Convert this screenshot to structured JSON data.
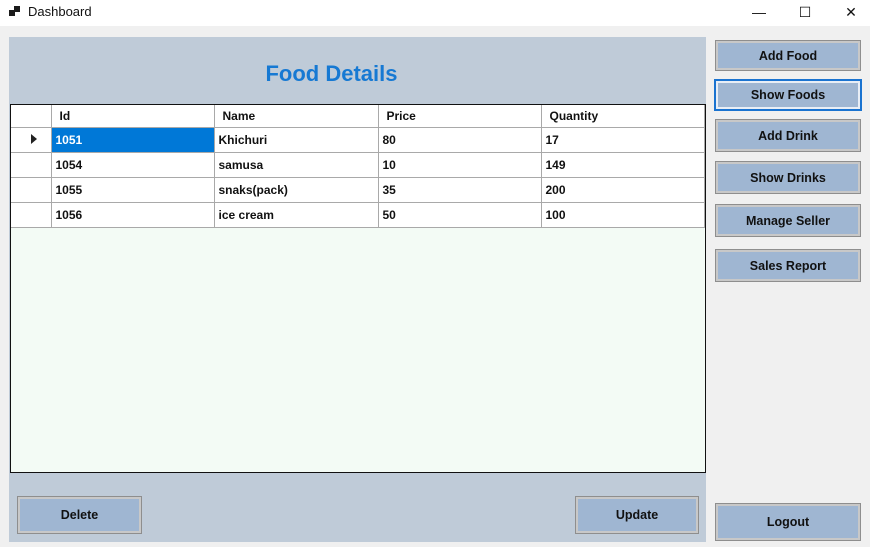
{
  "window": {
    "title": "Dashboard",
    "minimize_glyph": "—",
    "maximize_glyph": "☐",
    "close_glyph": "✕"
  },
  "main": {
    "heading": "Food Details",
    "table": {
      "columns": [
        "Id",
        "Name",
        "Price",
        "Quantity"
      ],
      "rows": [
        [
          "1051",
          "Khichuri",
          "80",
          "17"
        ],
        [
          "1054",
          "samusa",
          "10",
          "149"
        ],
        [
          "1055",
          "snaks(pack)",
          "35",
          "200"
        ],
        [
          "1056",
          "ice cream",
          "50",
          "100"
        ]
      ]
    },
    "delete_label": "Delete",
    "update_label": "Update"
  },
  "sidebar": {
    "add_food": "Add Food",
    "show_foods": "Show Foods",
    "add_drink": "Add Drink",
    "show_drinks": "Show Drinks",
    "manage_seller": "Manage Seller",
    "sales_report": "Sales Report",
    "logout": "Logout"
  },
  "colors": {
    "panel": "#bfcbd8",
    "button": "#9fb6d2",
    "heading": "#1679d3",
    "selection": "#0078d7",
    "grid_background": "#f3fbf5"
  }
}
